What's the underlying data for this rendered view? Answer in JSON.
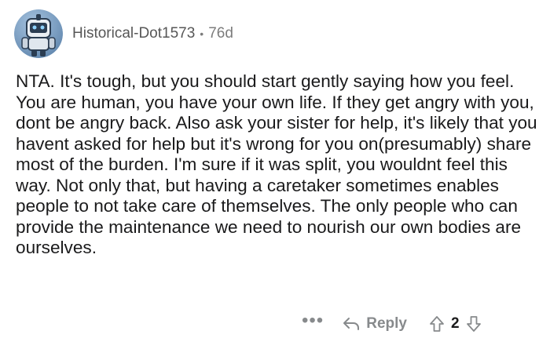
{
  "comment": {
    "author": "Historical-Dot1573",
    "separator": "•",
    "age": "76d",
    "body": "NTA. It's tough, but you should start gently saying how you feel. You are human, you have your own life. If they get angry with you, dont be angry back. Also ask your sister for help, it's likely that you havent asked for help but it's wrong for you on(presumably) share most of the burden. I'm sure if it was split, you wouldnt feel this way.  Not only that, but having a caretaker sometimes enables people to not take care of themselves. The only people who can provide the maintenance we need to nourish our own bodies are ourselves."
  },
  "actions": {
    "more_label": "•••",
    "reply_label": "Reply",
    "score": "2"
  },
  "icons": {
    "avatar": "robot-snoo-avatar",
    "reply": "reply-arrow-icon",
    "upvote": "upvote-arrow-icon",
    "downvote": "downvote-arrow-icon"
  },
  "colors": {
    "text": "#1a1a1b",
    "meta": "#7c7c7c",
    "action": "#878a8c",
    "avatar_bg": "#6b8fb5"
  }
}
